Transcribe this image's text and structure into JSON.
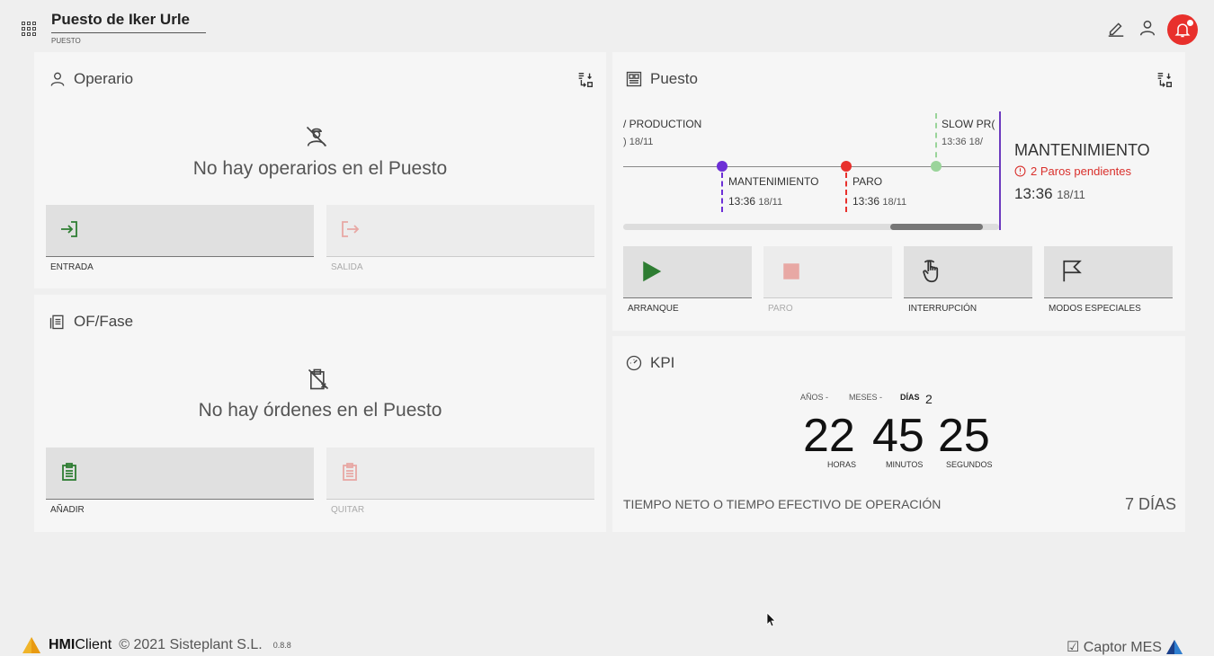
{
  "header": {
    "title": "Puesto de Iker Urle",
    "subtitle": "PUESTO"
  },
  "operario": {
    "title": "Operario",
    "empty_text": "No hay operarios en el Puesto",
    "buttons": [
      {
        "label": "ENTRADA",
        "enabled": true,
        "icon": "login-icon"
      },
      {
        "label": "SALIDA",
        "enabled": false,
        "icon": "logout-icon"
      }
    ]
  },
  "of_fase": {
    "title": "OF/Fase",
    "empty_text": "No hay órdenes en el Puesto",
    "buttons": [
      {
        "label": "AÑADIR",
        "enabled": true,
        "icon": "clipboard-add-icon"
      },
      {
        "label": "QUITAR",
        "enabled": false,
        "icon": "clipboard-remove-icon"
      }
    ]
  },
  "puesto": {
    "title": "Puesto",
    "timeline": {
      "events": [
        {
          "label": "/ PRODUCTION",
          "time": ") 18/11",
          "color": "#888888"
        },
        {
          "label": "MANTENIMIENTO",
          "time": "13:36",
          "date": "18/11",
          "color": "#6d2fd6"
        },
        {
          "label": "PARO",
          "time": "13:36",
          "date": "18/11",
          "color": "#e8302c"
        },
        {
          "label": "SLOW PR(",
          "time": "13:36",
          "date": "18/",
          "color": "#9ad49a"
        }
      ]
    },
    "status": {
      "title": "MANTENIMIENTO",
      "alert": "2 Paros pendientes",
      "time": "13:36",
      "date": "18/11"
    },
    "modes": [
      {
        "label": "ARRANQUE",
        "enabled": true,
        "icon": "play-icon",
        "color": "#2e7d32"
      },
      {
        "label": "PARO",
        "enabled": false,
        "icon": "stop-icon",
        "color": "#e8a8a4"
      },
      {
        "label": "INTERRUPCIÓN",
        "enabled": true,
        "icon": "hand-pointer-icon"
      },
      {
        "label": "MODOS ESPECIALES",
        "enabled": true,
        "icon": "flag-icon"
      }
    ]
  },
  "kpi": {
    "title": "KPI",
    "anos_label": "AÑOS -",
    "meses_label": "MESES -",
    "dias_label": "DÍAS",
    "dias_value": "2",
    "hours": "22",
    "minutes": "45",
    "seconds": "25",
    "hours_label": "HORAS",
    "minutes_label": "MINUTOS",
    "seconds_label": "SEGUNDOS",
    "footer_label": "TIEMPO NETO O TIEMPO EFECTIVO DE OPERACIÓN",
    "footer_value": "7 DÍAS"
  },
  "footer": {
    "brand_bold": "HMI",
    "brand_rest": "Client",
    "copyright": "© 2021 Sisteplant S.L.",
    "version": "0.8.8",
    "right_label": "☑ Captor MES"
  }
}
